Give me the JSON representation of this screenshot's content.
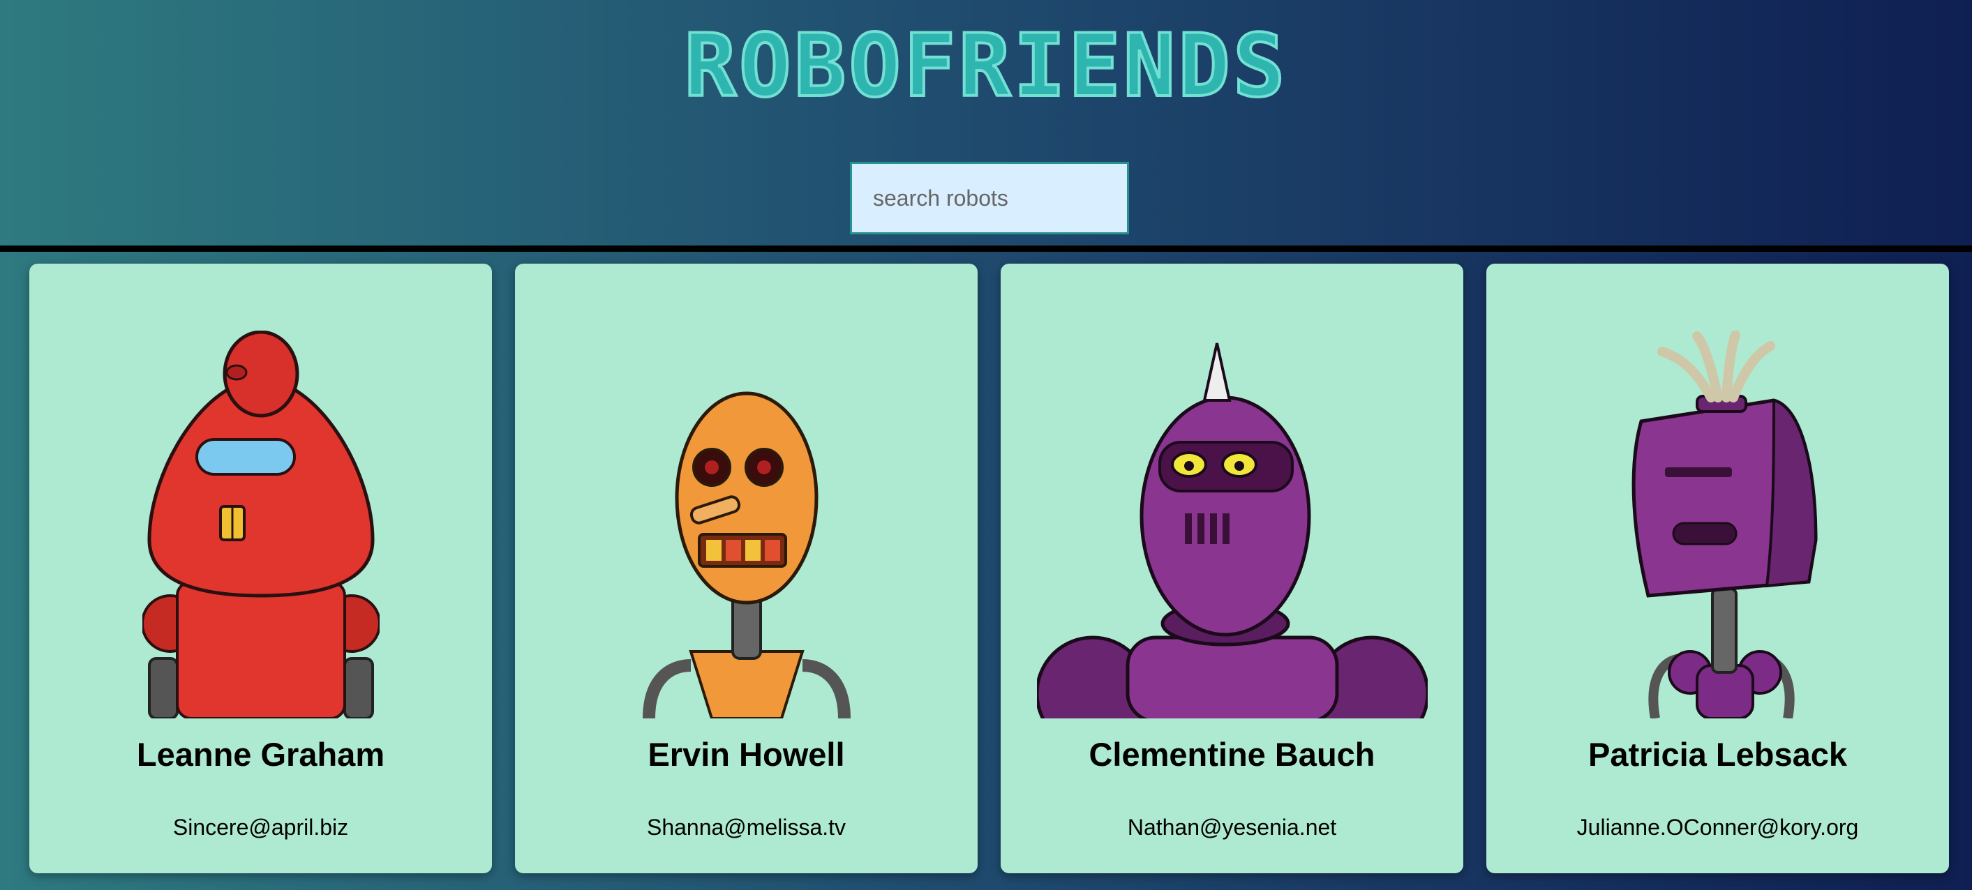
{
  "header": {
    "title": "ROBOFRIENDS",
    "search_placeholder": "search robots"
  },
  "robots": [
    {
      "name": "Leanne Graham",
      "email": "Sincere@april.biz",
      "avatar_icon": "red-robot-avatar",
      "color": "#e0362e"
    },
    {
      "name": "Ervin Howell",
      "email": "Shanna@melissa.tv",
      "avatar_icon": "orange-robot-avatar",
      "color": "#f0983a"
    },
    {
      "name": "Clementine Bauch",
      "email": "Nathan@yesenia.net",
      "avatar_icon": "purple-robot-avatar",
      "color": "#8a3590"
    },
    {
      "name": "Patricia Lebsack",
      "email": "Julianne.OConner@kory.org",
      "avatar_icon": "violet-robot-avatar",
      "color": "#7c2c86"
    }
  ]
}
